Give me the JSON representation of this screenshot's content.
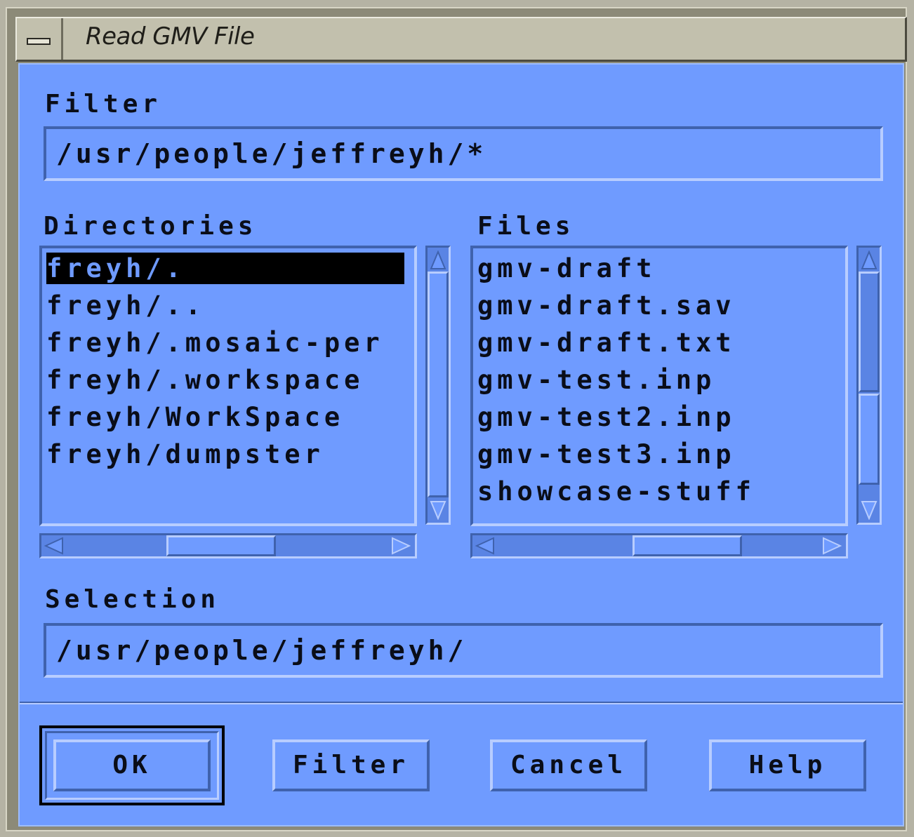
{
  "window": {
    "title": "Read GMV File"
  },
  "filter": {
    "label": "Filter",
    "value": "/usr/people/jeffreyh/*"
  },
  "directories": {
    "label": "Directories",
    "items": [
      "freyh/.",
      "freyh/..",
      "freyh/.mosaic-per",
      "freyh/.workspace",
      "freyh/WorkSpace",
      "freyh/dumpster"
    ],
    "selected_index": 0
  },
  "files": {
    "label": "Files",
    "items": [
      "gmv-draft",
      "gmv-draft.sav",
      "gmv-draft.txt",
      "gmv-test.inp",
      "gmv-test2.inp",
      "gmv-test3.inp",
      "showcase-stuff"
    ]
  },
  "selection": {
    "label": "Selection",
    "value": "/usr/people/jeffreyh/"
  },
  "buttons": {
    "ok": "OK",
    "filter": "Filter",
    "cancel": "Cancel",
    "help": "Help"
  },
  "icons": {
    "window_menu": "window-menu-icon",
    "arrow_up": "arrow-up-icon",
    "arrow_down": "arrow-down-icon",
    "arrow_left": "arrow-left-icon",
    "arrow_right": "arrow-right-icon"
  },
  "colors": {
    "dialog_bg": "#6f9bff",
    "titlebar_bg": "#c2c0ad",
    "selected_bg": "#000000"
  }
}
